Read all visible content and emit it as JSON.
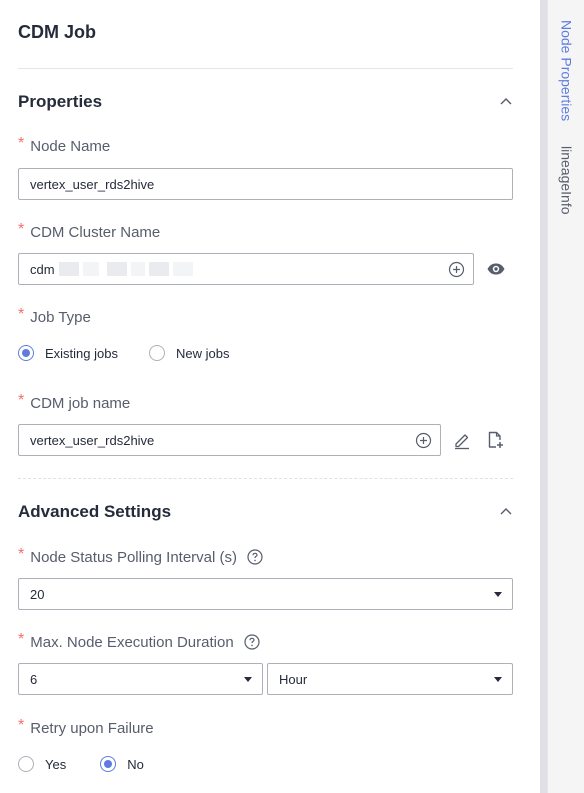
{
  "panel": {
    "title": "CDM Job"
  },
  "properties": {
    "title": "Properties",
    "node_name": {
      "label": "Node Name",
      "value": "vertex_user_rds2hive"
    },
    "cluster_name": {
      "label": "CDM Cluster Name",
      "value": "cdm"
    },
    "job_type": {
      "label": "Job Type",
      "options": [
        "Existing jobs",
        "New jobs"
      ],
      "selected": "Existing jobs"
    },
    "job_name": {
      "label": "CDM job name",
      "value": "vertex_user_rds2hive"
    }
  },
  "advanced": {
    "title": "Advanced Settings",
    "polling": {
      "label": "Node Status Polling Interval (s)",
      "value": "20"
    },
    "duration": {
      "label": "Max. Node Execution Duration",
      "value": "6",
      "unit": "Hour"
    },
    "retry": {
      "label": "Retry upon Failure",
      "options": [
        "Yes",
        "No"
      ],
      "selected": "No"
    }
  },
  "right_tabs": {
    "node_properties": "Node Properties",
    "lineage_info": "lineageInfo"
  },
  "icons": {
    "collapse": "chevron-up-icon",
    "add": "plus-circle-icon",
    "view": "eye-icon",
    "edit": "pencil-icon",
    "new": "new-file-icon",
    "help": "question-circle-icon"
  },
  "colors": {
    "accent": "#5e7ce0",
    "required": "#f66f6a"
  }
}
